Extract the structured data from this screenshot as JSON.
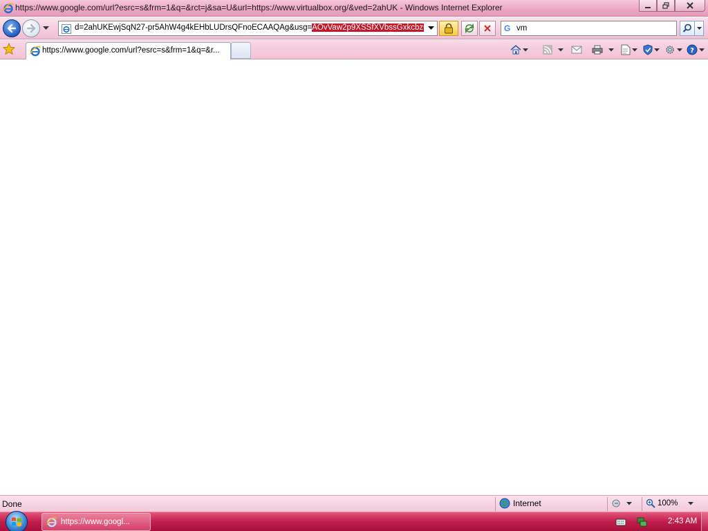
{
  "window": {
    "title": "https://www.google.com/url?esrc=s&frm=1&q=&rct=j&sa=U&url=https://www.virtualbox.org/&ved=2ahUK - Windows Internet Explorer",
    "minimize_icon": "minimize-icon",
    "restore_icon": "restore-icon",
    "close_icon": "close-icon"
  },
  "navigation": {
    "back_icon": "back-arrow-icon",
    "forward_icon": "forward-arrow-icon",
    "address": {
      "url_visible": "d=2ahUKEwjSqN27-pr5AhW4g4kEHbLUDrsQFnoECAAQAg&usg=",
      "url_selected": "AOvVaw2p9XSSfXVbssGxkcbzGiE7"
    },
    "search": {
      "provider": "G",
      "value": "vm"
    }
  },
  "tabs": [
    {
      "label": "https://www.google.com/url?esrc=s&frm=1&q=&r...",
      "active": true
    }
  ],
  "status": {
    "text": "Done",
    "zone": "Internet",
    "zoom": "100%"
  },
  "taskbar": {
    "item_label": "https://www.googl...",
    "clock": "2:43 AM"
  },
  "colors": {
    "accent_pink": "#e79abb",
    "taskbar_red": "#c11d4a",
    "selection_red": "#c2182b"
  }
}
